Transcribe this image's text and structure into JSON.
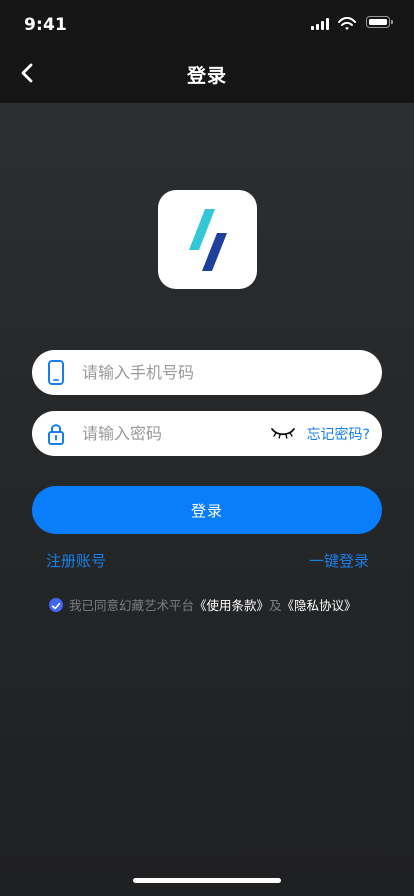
{
  "status_bar": {
    "time": "9:41"
  },
  "header": {
    "title": "登录"
  },
  "form": {
    "phone_placeholder": "请输入手机号码",
    "password_placeholder": "请输入密码",
    "forgot_password_label": "忘记密码?",
    "login_button_label": "登录"
  },
  "links": {
    "register_label": "注册账号",
    "one_tap_login_label": "一键登录"
  },
  "agreement": {
    "checked": true,
    "prefix": "我已同意幻藏艺术平台",
    "terms_label": "《使用条款》",
    "connector": "及",
    "privacy_label": "《隐私协议》"
  },
  "colors": {
    "accent_blue": "#0a7dfb",
    "link_blue": "#1a7fe8",
    "checkbox_blue": "#3f67f0",
    "background_dark": "#26282a",
    "logo_cyan": "#33c7d8",
    "logo_navy": "#1e3f9b"
  },
  "icons": {
    "back": "chevron-left-icon",
    "signal": "cellular-signal-icon",
    "wifi": "wifi-icon",
    "battery": "battery-icon",
    "phone": "mobile-phone-icon",
    "lock": "lock-icon",
    "password_visibility": "eye-closed-icon",
    "agreement_checkbox": "check-icon"
  }
}
